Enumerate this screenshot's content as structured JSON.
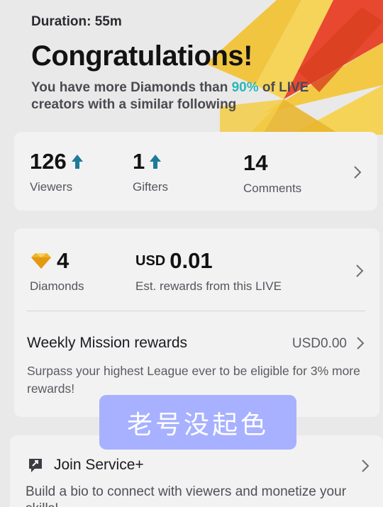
{
  "header": {
    "duration": "Duration: 55m",
    "title": "Congratulations!",
    "subtitle_before": "You have more Diamonds than ",
    "subtitle_pct": "90%",
    "subtitle_after": " of LIVE creators with a similar following"
  },
  "stats": {
    "viewers": {
      "value": "126",
      "label": "Viewers"
    },
    "gifters": {
      "value": "1",
      "label": "Gifters"
    },
    "comments": {
      "value": "14",
      "label": "Comments"
    }
  },
  "rewards": {
    "diamonds_value": "4",
    "diamonds_label": "Diamonds",
    "usd_currency": "USD",
    "usd_value": "0.01",
    "usd_label": "Est. rewards from this LIVE"
  },
  "mission": {
    "title": "Weekly Mission rewards",
    "amount": "USD0.00",
    "description": "Surpass your highest League ever to be eligible for 3% more rewards!"
  },
  "overlay": {
    "text": "老号没起色"
  },
  "service": {
    "title": "Join Service+",
    "description": "Build a bio to connect with viewers and monetize your skills!"
  },
  "colors": {
    "accent_teal": "#2bb7b4",
    "arrow_blue": "#1e7a99",
    "overlay_purple": "#a7b1ff"
  },
  "icons": {
    "up_arrow": "arrow-up-icon",
    "chevron": "chevron-right-icon",
    "diamond": "diamond-icon",
    "service": "service-plus-icon"
  }
}
